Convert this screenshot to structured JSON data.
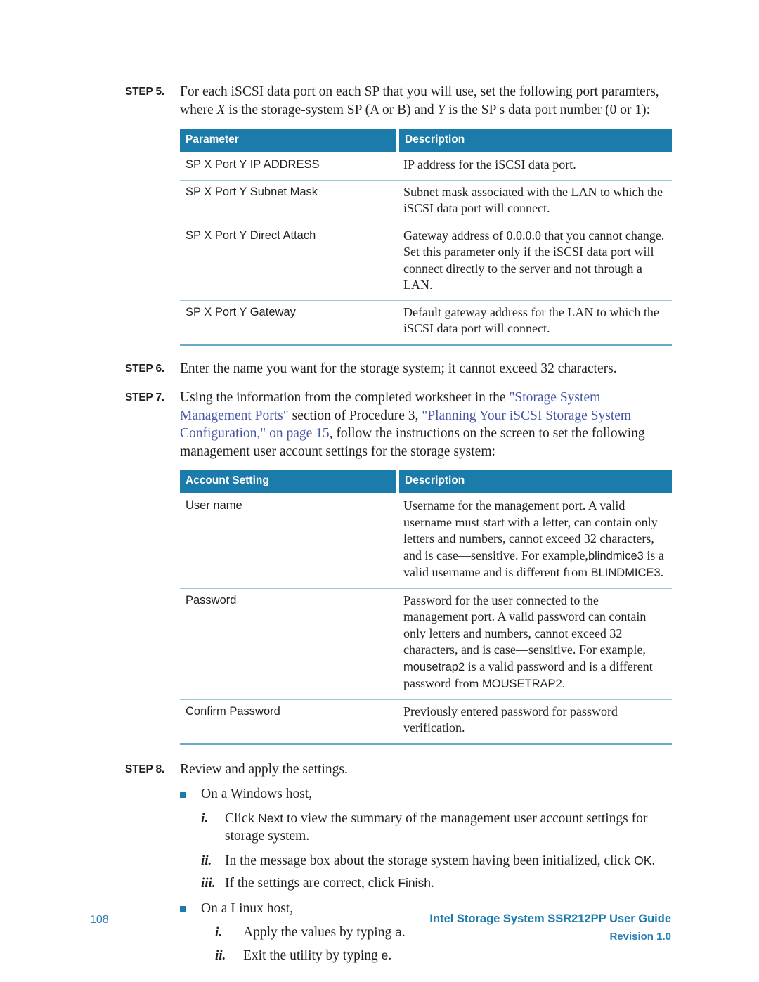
{
  "document": {
    "page_number": "108",
    "footer_title": "Intel Storage System SSR212PP User Guide",
    "footer_revision": "Revision 1.0"
  },
  "colors": {
    "table_header_bg": "#1b7bab",
    "table_rule": "#9cc6dc",
    "table_bottom_rule": "#6ba9c7",
    "crossref_link": "#4656a6",
    "bullet_square": "#1b7bab",
    "footer_text": "#1b7bab",
    "body_text": "#231f20"
  },
  "steps": [
    {
      "label": "STEP 5.",
      "text_part_1": "For each iSCSI data port on each SP that you will use, set the following port paramters, where ",
      "italic_1": "X",
      "text_part_2": " is the storage-system SP (A or B) and ",
      "italic_2": "Y",
      "text_part_3": " is the SP s data port number (0 or 1):"
    },
    {
      "label": "STEP 6.",
      "text": "Enter the name you want for the storage system; it cannot exceed 32 characters."
    },
    {
      "label": "STEP 7.",
      "text_part_1": "Using the information from the completed worksheet in the ",
      "link_1": "\"Storage System Management Ports\"",
      "text_part_2": " section of Procedure 3, ",
      "link_2": "\"Planning Your iSCSI Storage System Configuration,\" on page 15",
      "text_part_3": ", follow the instructions on the screen to set the following management user account settings for the storage system:"
    },
    {
      "label": "STEP 8.",
      "text": "Review and apply the settings."
    }
  ],
  "table_parameters": {
    "headers": [
      "Parameter",
      "Description"
    ],
    "rows": [
      {
        "parameter": "SP X Port Y IP ADDRESS",
        "description": "IP address for the iSCSI data port."
      },
      {
        "parameter": "SP X Port Y Subnet Mask",
        "description": "Subnet mask associated with the LAN to which the iSCSI data port will connect."
      },
      {
        "parameter": "SP X Port Y Direct Attach",
        "description": "Gateway address of 0.0.0.0 that you cannot change. Set this parameter only if the iSCSI data port will connect directly to the server and not through a LAN."
      },
      {
        "parameter": "SP X Port Y Gateway",
        "description": "Default gateway address for the LAN to which the iSCSI data port will connect."
      }
    ]
  },
  "table_account_settings": {
    "headers": [
      "Account Setting",
      "Description"
    ],
    "rows": [
      {
        "setting": "User name",
        "desc_part_1": "Username for the management port. A valid username must start with a letter, can contain only letters and numbers, cannot exceed 32 characters, and is case—sensitive. For example,",
        "desc_ui_1": "blindmice3",
        "desc_part_2": " is a valid username and is different from ",
        "desc_ui_2": "BLINDMICE3",
        "desc_part_3": "."
      },
      {
        "setting": "Password",
        "desc_part_1": "Password for the user connected to the management port. A valid password can contain only letters and numbers, cannot exceed 32 characters, and is case—sensitive. For example, ",
        "desc_ui_1": "mousetrap2",
        "desc_part_2": " is a valid password and is a different password from ",
        "desc_ui_2": "MOUSETRAP2.",
        "desc_part_3": ""
      },
      {
        "setting": "Confirm Password",
        "desc_part_1": "Previously entered password for password verification.",
        "desc_ui_1": "",
        "desc_part_2": "",
        "desc_ui_2": "",
        "desc_part_3": ""
      }
    ]
  },
  "step8_lists": {
    "windows_bullet": "On a Windows host,",
    "windows_items": [
      {
        "marker": "i.",
        "text_part_1": "Click ",
        "ui": "Next",
        "text_part_2": " to view the summary of the management user account settings for storage system."
      },
      {
        "marker": "ii.",
        "text_part_1": "In the message box about the storage system having been initialized, click ",
        "ui": "OK",
        "text_part_2": "."
      },
      {
        "marker": "iii.",
        "text_part_1": "If the settings are correct, click ",
        "ui": "Finish",
        "text_part_2": "."
      }
    ],
    "linux_bullet": "On a Linux host,",
    "linux_items": [
      {
        "marker": "i.",
        "text_part_1": "Apply the values by typing ",
        "ui": "a",
        "text_part_2": "."
      },
      {
        "marker": "ii.",
        "text_part_1": "Exit the utility by typing ",
        "ui": "e",
        "text_part_2": "."
      }
    ]
  }
}
